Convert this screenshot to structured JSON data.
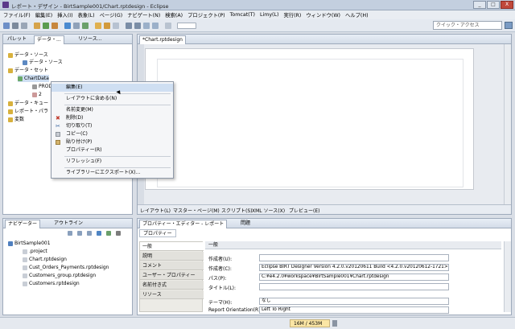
{
  "window": {
    "title": "レポート・デザイン - BirtSample001/Chart.rptdesign - Eclipse",
    "min": "_",
    "max": "□",
    "close": "X"
  },
  "menu": [
    "ファイル(F)",
    "編集(E)",
    "挿入(I)",
    "表象(L)",
    "ページ(G)",
    "ナビゲート(N)",
    "検索(A)",
    "プロジェクト(P)",
    "Tomcat(T)",
    "Limy(L)",
    "実行(R)",
    "ウィンドウ(W)",
    "ヘルプ(H)"
  ],
  "toolbar": {
    "quick_access": "クイック・アクセス"
  },
  "left_tabs": [
    "パレット",
    "データ・...",
    "リソース..."
  ],
  "tree": {
    "data_source": "データ・ソース",
    "data_source_child": "データ・ソース",
    "data_set": "データ・セット",
    "data_set_child": "ChartData",
    "child1": "PRODU",
    "child2": "2",
    "cube": "データ・キュー",
    "report_param": "レポート・パラ",
    "variable": "変数"
  },
  "context_menu": {
    "items": [
      "編集(E)",
      "レイアウトに含める(N)",
      "名前変更(M)",
      "削除(D)",
      "切り取り(T)",
      "コピー(C)",
      "貼り付け(P)",
      "プロパティー(R)",
      "リフレッシュ(F)",
      "ライブラリーにエクスポート(X)..."
    ]
  },
  "editor": {
    "tab": "*Chart.rptdesign",
    "bottom_tabs": [
      "レイアウト(L)",
      "マスター・ページ(M)",
      "スクリプト(S)",
      "XML ソース(X)",
      "プレビュー(E)"
    ]
  },
  "navigator": {
    "tabs": [
      "ナビゲーター",
      "アウトライン"
    ],
    "project": "BirtSample001",
    "files": [
      ".project",
      "Chart.rptdesign",
      "Cust_Orders_Payments.rptdesign",
      "Customers_group.rptdesign",
      "Customers.rptdesign"
    ]
  },
  "properties": {
    "tabs": [
      "プロパティー・エディター - レポート",
      "問題"
    ],
    "subtab": "プロパティー",
    "section": "一般",
    "categories": [
      "一般",
      "説明",
      "コメント",
      "ユーザー・プロパティー",
      "名前付き式",
      "リソース"
    ],
    "fields": [
      {
        "label": "作成者(U):",
        "value": ""
      },
      {
        "label": "作成者(C):",
        "value": "Eclipse BIRT Designer Version 4.2.0.v20120611 Build <4.2.0.v20120612-1721>"
      },
      {
        "label": "パス(P):",
        "value": "C:¥e4.2.0¥workspace¥BirtSample001¥Chart.rptdesign"
      },
      {
        "label": "タイトル(L):",
        "value": ""
      }
    ],
    "theme_label": "テーマ(H):",
    "theme_value": "なし",
    "orient_label": "Report Orientation(R):",
    "orient_value": "Left To Right"
  },
  "status": {
    "memory": "16M",
    "of": "/ 453M"
  }
}
